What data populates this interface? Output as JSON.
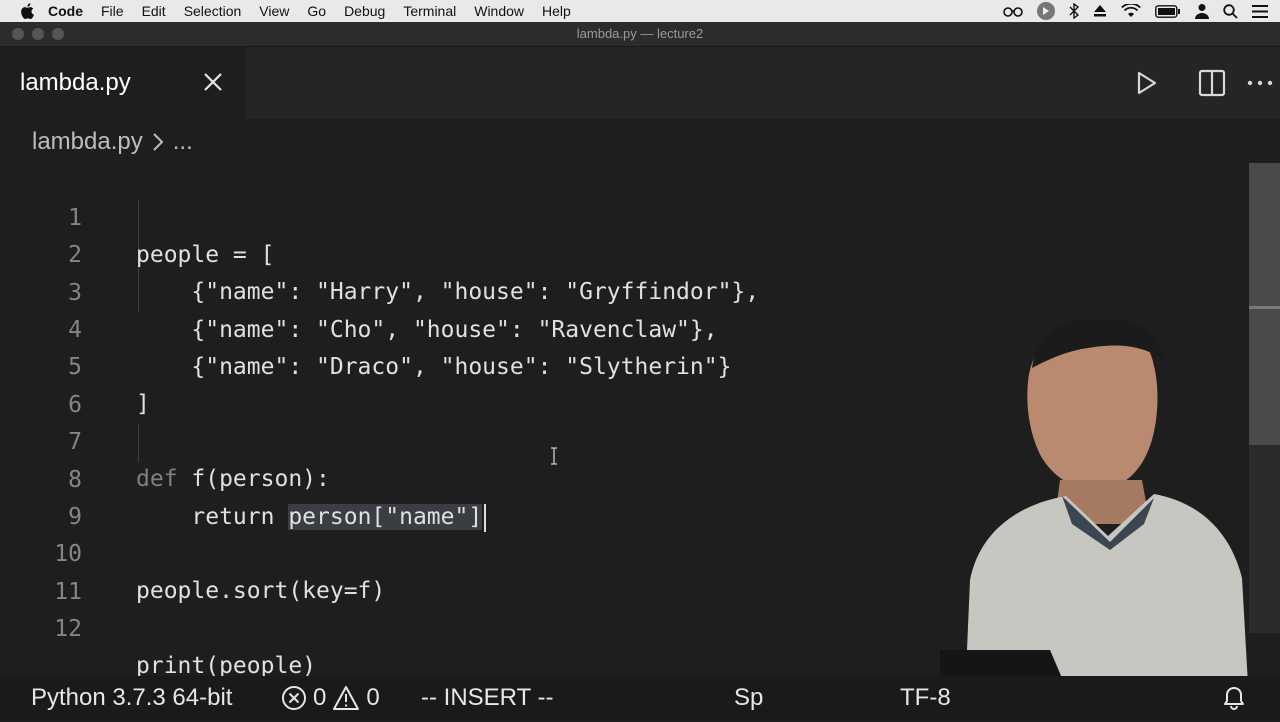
{
  "menubar": {
    "items": [
      "Code",
      "File",
      "Edit",
      "Selection",
      "View",
      "Go",
      "Debug",
      "Terminal",
      "Window",
      "Help"
    ]
  },
  "window": {
    "title": "lambda.py — lecture2"
  },
  "tab": {
    "label": "lambda.py"
  },
  "breadcrumb": {
    "file": "lambda.py",
    "more": "..."
  },
  "editor": {
    "lines": [
      {
        "n": "1",
        "text": "people = ["
      },
      {
        "n": "2",
        "text": "    {\"name\": \"Harry\", \"house\": \"Gryffindor\"},"
      },
      {
        "n": "3",
        "text": "    {\"name\": \"Cho\", \"house\": \"Ravenclaw\"},"
      },
      {
        "n": "4",
        "text": "    {\"name\": \"Draco\", \"house\": \"Slytherin\"}"
      },
      {
        "n": "5",
        "text": "]"
      },
      {
        "n": "6",
        "text": ""
      },
      {
        "n": "7",
        "kw": "def",
        "rest": " f(person):"
      },
      {
        "n": "8",
        "pre": "    return ",
        "sel": "person[\"name\"]"
      },
      {
        "n": "9",
        "text": ""
      },
      {
        "n": "10",
        "text": "people.sort(key=f)"
      },
      {
        "n": "11",
        "text": ""
      },
      {
        "n": "12",
        "text": "print(people)"
      }
    ]
  },
  "statusbar": {
    "interpreter": "Python 3.7.3 64-bit",
    "errors": "0",
    "warnings": "0",
    "mode": "-- INSERT --",
    "spaces_partial": "Sp",
    "encoding_partial": "TF-8"
  },
  "icons": {
    "close": "close-icon",
    "run": "play-icon",
    "split": "split-editor-icon",
    "more": "more-icon",
    "bell": "bell-icon"
  }
}
